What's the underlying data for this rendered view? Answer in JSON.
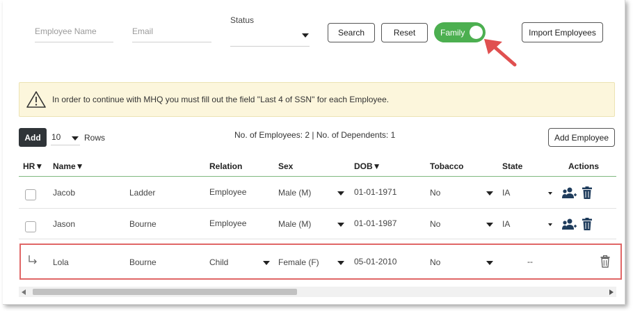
{
  "filters": {
    "employee_name_placeholder": "Employee Name",
    "email_placeholder": "Email",
    "status_label": "Status",
    "status_value": "",
    "search_label": "Search",
    "reset_label": "Reset",
    "family_toggle_label": "Family",
    "family_toggle_on": true,
    "import_label": "Import Employees"
  },
  "alert": {
    "icon": "warning-triangle-icon",
    "text": "In order to continue with MHQ you must fill out the field \"Last 4 of SSN\" for each Employee."
  },
  "controls": {
    "add_label": "Add",
    "rows_value": "10",
    "rows_label": "Rows",
    "summary": "No. of Employees: 2 | No. of Dependents: 1",
    "add_employee_label": "Add Employee"
  },
  "table": {
    "headers": {
      "hr": "HR▼",
      "name": "Name▼",
      "relation": "Relation",
      "sex": "Sex",
      "dob": "DOB▼",
      "tobacco": "Tobacco",
      "state": "State",
      "actions": "Actions"
    },
    "rows": [
      {
        "first": "Jacob",
        "last": "Ladder",
        "relation": "Employee",
        "sex": "Male (M)",
        "dob": "01-01-1971",
        "tobacco": "No",
        "state": "IA"
      },
      {
        "first": "Jason",
        "last": "Bourne",
        "relation": "Employee",
        "sex": "Male (M)",
        "dob": "01-01-1987",
        "tobacco": "No",
        "state": "IA"
      },
      {
        "first": "Lola",
        "last": "Bourne",
        "relation": "Child",
        "sex": "Female (F)",
        "dob": "05-01-2010",
        "tobacco": "No",
        "state": "--"
      }
    ]
  },
  "colors": {
    "toggle_green": "#4caf50",
    "alert_bg": "#fcf6dc",
    "annotation_red": "#e06666",
    "action_icon_blue": "#1f3c5c"
  }
}
